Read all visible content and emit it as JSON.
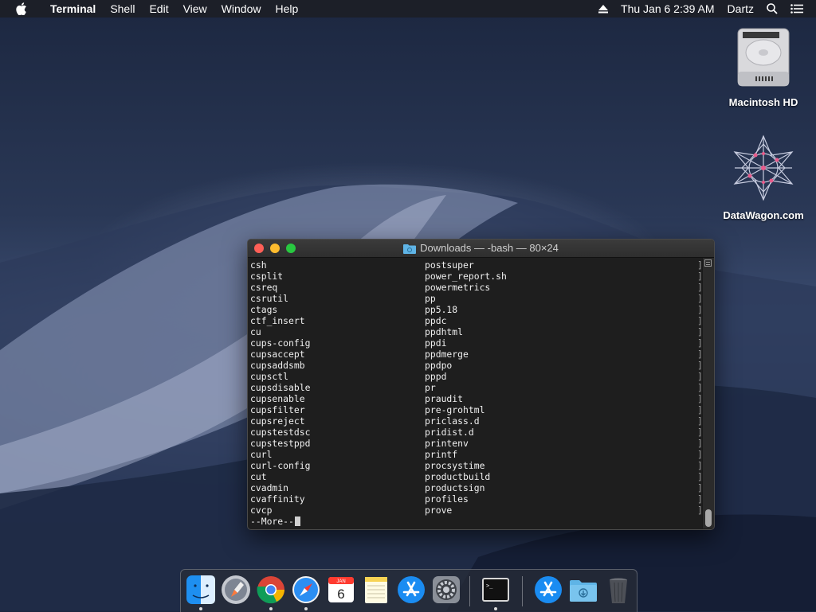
{
  "menubar": {
    "app_name": "Terminal",
    "menus": [
      "Shell",
      "Edit",
      "View",
      "Window",
      "Help"
    ],
    "clock": "Thu Jan 6  2:39 AM",
    "user": "Dartz"
  },
  "desktop_icons": [
    {
      "label": "Macintosh HD",
      "icon": "hard-drive-icon"
    },
    {
      "label": "DataWagon.com",
      "icon": "star-network-icon"
    }
  ],
  "terminal": {
    "title": "Downloads — -bash — 80×24",
    "rows": [
      [
        "csh",
        "postsuper"
      ],
      [
        "csplit",
        "power_report.sh"
      ],
      [
        "csreq",
        "powermetrics"
      ],
      [
        "csrutil",
        "pp"
      ],
      [
        "ctags",
        "pp5.18"
      ],
      [
        "ctf_insert",
        "ppdc"
      ],
      [
        "cu",
        "ppdhtml"
      ],
      [
        "cups-config",
        "ppdi"
      ],
      [
        "cupsaccept",
        "ppdmerge"
      ],
      [
        "cupsaddsmb",
        "ppdpo"
      ],
      [
        "cupsctl",
        "pppd"
      ],
      [
        "cupsdisable",
        "pr"
      ],
      [
        "cupsenable",
        "praudit"
      ],
      [
        "cupsfilter",
        "pre-grohtml"
      ],
      [
        "cupsreject",
        "priclass.d"
      ],
      [
        "cupstestdsc",
        "pridist.d"
      ],
      [
        "cupstestppd",
        "printenv"
      ],
      [
        "curl",
        "printf"
      ],
      [
        "curl-config",
        "procsystime"
      ],
      [
        "cut",
        "productbuild"
      ],
      [
        "cvadmin",
        "productsign"
      ],
      [
        "cvaffinity",
        "profiles"
      ],
      [
        "cvcp",
        "prove"
      ]
    ],
    "pager_prompt": "--More--"
  },
  "dock": {
    "calendar_month": "JAN",
    "calendar_day": "6",
    "apps": [
      "finder-icon",
      "launchpad-icon",
      "chrome-icon",
      "safari-icon",
      "calendar-icon",
      "notes-icon",
      "app-store-icon",
      "system-preferences-icon",
      "terminal-icon",
      "app-store-icon",
      "downloads-folder-icon",
      "trash-icon"
    ]
  }
}
